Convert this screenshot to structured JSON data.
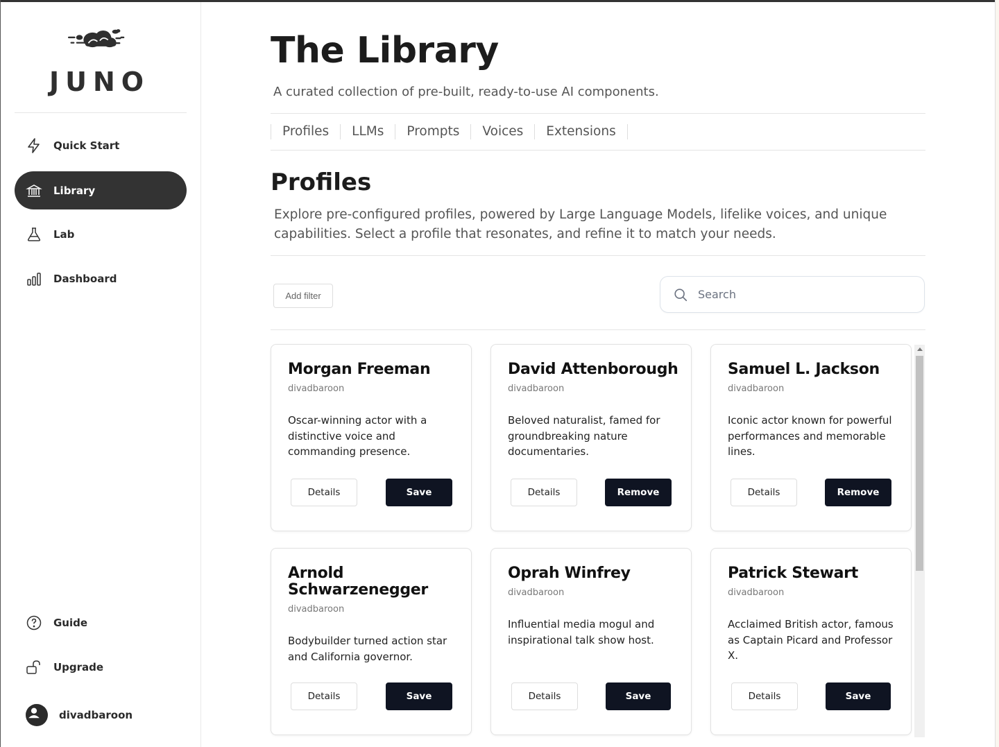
{
  "app": {
    "logo_text": "JUNO"
  },
  "sidebar": {
    "nav": [
      {
        "label": "Quick Start",
        "icon": "lightning-icon"
      },
      {
        "label": "Library",
        "icon": "bank-icon",
        "active": true
      },
      {
        "label": "Lab",
        "icon": "flask-icon"
      },
      {
        "label": "Dashboard",
        "icon": "bar-chart-icon"
      }
    ],
    "bottom": [
      {
        "label": "Guide",
        "icon": "help-circle-icon"
      },
      {
        "label": "Upgrade",
        "icon": "unlock-icon"
      }
    ],
    "user": {
      "name": "divadbaroon",
      "icon": "avatar-icon"
    }
  },
  "header": {
    "title": "The Library",
    "subtitle": "A curated collection of pre-built, ready-to-use AI components."
  },
  "tabs": [
    "Profiles",
    "LLMs",
    "Prompts",
    "Voices",
    "Extensions"
  ],
  "section": {
    "title": "Profiles",
    "description": "Explore pre-configured profiles, powered by Large Language Models, lifelike voices, and unique capabilities. Select a profile that resonates, and refine it to match your needs."
  },
  "toolbar": {
    "add_filter": "Add filter",
    "search_placeholder": "Search"
  },
  "cards": [
    {
      "name": "Morgan Freeman",
      "author": "divadbaroon",
      "description": "Oscar-winning actor with a distinctive voice and commanding presence.",
      "details": "Details",
      "action": "Save"
    },
    {
      "name": "David Attenborough",
      "author": "divadbaroon",
      "description": "Beloved naturalist, famed for groundbreaking nature documentaries.",
      "details": "Details",
      "action": "Remove"
    },
    {
      "name": "Samuel L. Jackson",
      "author": "divadbaroon",
      "description": "Iconic actor known for powerful performances and memorable lines.",
      "details": "Details",
      "action": "Remove"
    },
    {
      "name": "Arnold Schwarzenegger",
      "author": "divadbaroon",
      "description": "Bodybuilder turned action star and California governor.",
      "details": "Details",
      "action": "Save"
    },
    {
      "name": "Oprah Winfrey",
      "author": "divadbaroon",
      "description": "Influential media mogul and inspirational talk show host.",
      "details": "Details",
      "action": "Save"
    },
    {
      "name": "Patrick Stewart",
      "author": "divadbaroon",
      "description": "Acclaimed British actor, famous as Captain Picard and Professor X.",
      "details": "Details",
      "action": "Save"
    }
  ]
}
